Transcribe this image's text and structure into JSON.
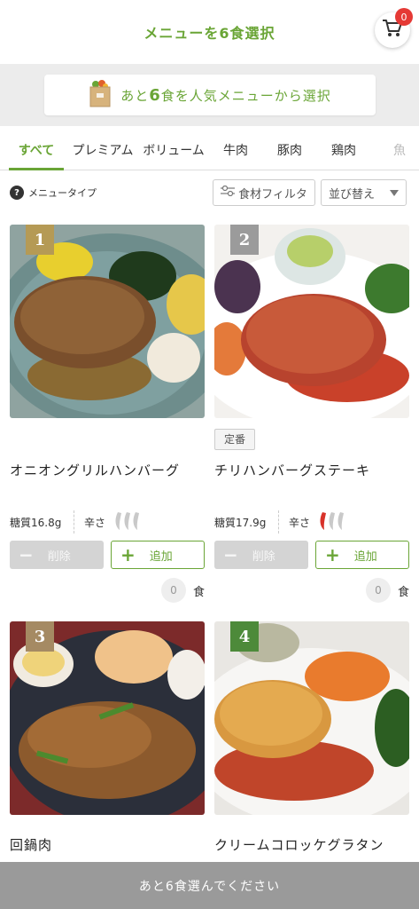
{
  "header": {
    "title": "メニューを6食選択",
    "cart_count": "0"
  },
  "banner": {
    "prefix": "あと",
    "count": "6",
    "suffix": "食を人気メニューから選択"
  },
  "tabs": [
    {
      "label": "すべて",
      "active": true
    },
    {
      "label": "プレミアム"
    },
    {
      "label": "ボリューム"
    },
    {
      "label": "牛肉"
    },
    {
      "label": "豚肉"
    },
    {
      "label": "鶏肉"
    },
    {
      "label": "魚"
    }
  ],
  "filters": {
    "menu_type": "メニュータイプ",
    "ingredient_filter": "食材フィルタ",
    "sort": "並び替え"
  },
  "cards": [
    {
      "rank": "1",
      "rank_color": "#b59a55",
      "badge": "",
      "name": "オニオングリルハンバーグ",
      "sugar": "糖質16.8g",
      "spicy_label": "辛さ",
      "spicy_level": 0,
      "delete_label": "削除",
      "add_label": "追加",
      "qty": "0",
      "unit": "食"
    },
    {
      "rank": "2",
      "rank_color": "#9b9b9b",
      "badge": "定番",
      "name": "チリハンバーグステーキ",
      "sugar": "糖質17.9g",
      "spicy_label": "辛さ",
      "spicy_level": 1,
      "delete_label": "削除",
      "add_label": "追加",
      "qty": "0",
      "unit": "食"
    },
    {
      "rank": "3",
      "rank_color": "#a58a63",
      "badge": "",
      "name": "回鍋肉"
    },
    {
      "rank": "4",
      "rank_color": "#4d8a3a",
      "badge": "",
      "name": "クリームコロッケグラタン"
    }
  ],
  "bottom_bar": {
    "label": "あと6食選んでください"
  },
  "colors": {
    "accent": "#6aa536",
    "cart_badge": "#e53935",
    "pepper_red": "#d8322a",
    "pepper_gray": "#c9c9c9"
  }
}
